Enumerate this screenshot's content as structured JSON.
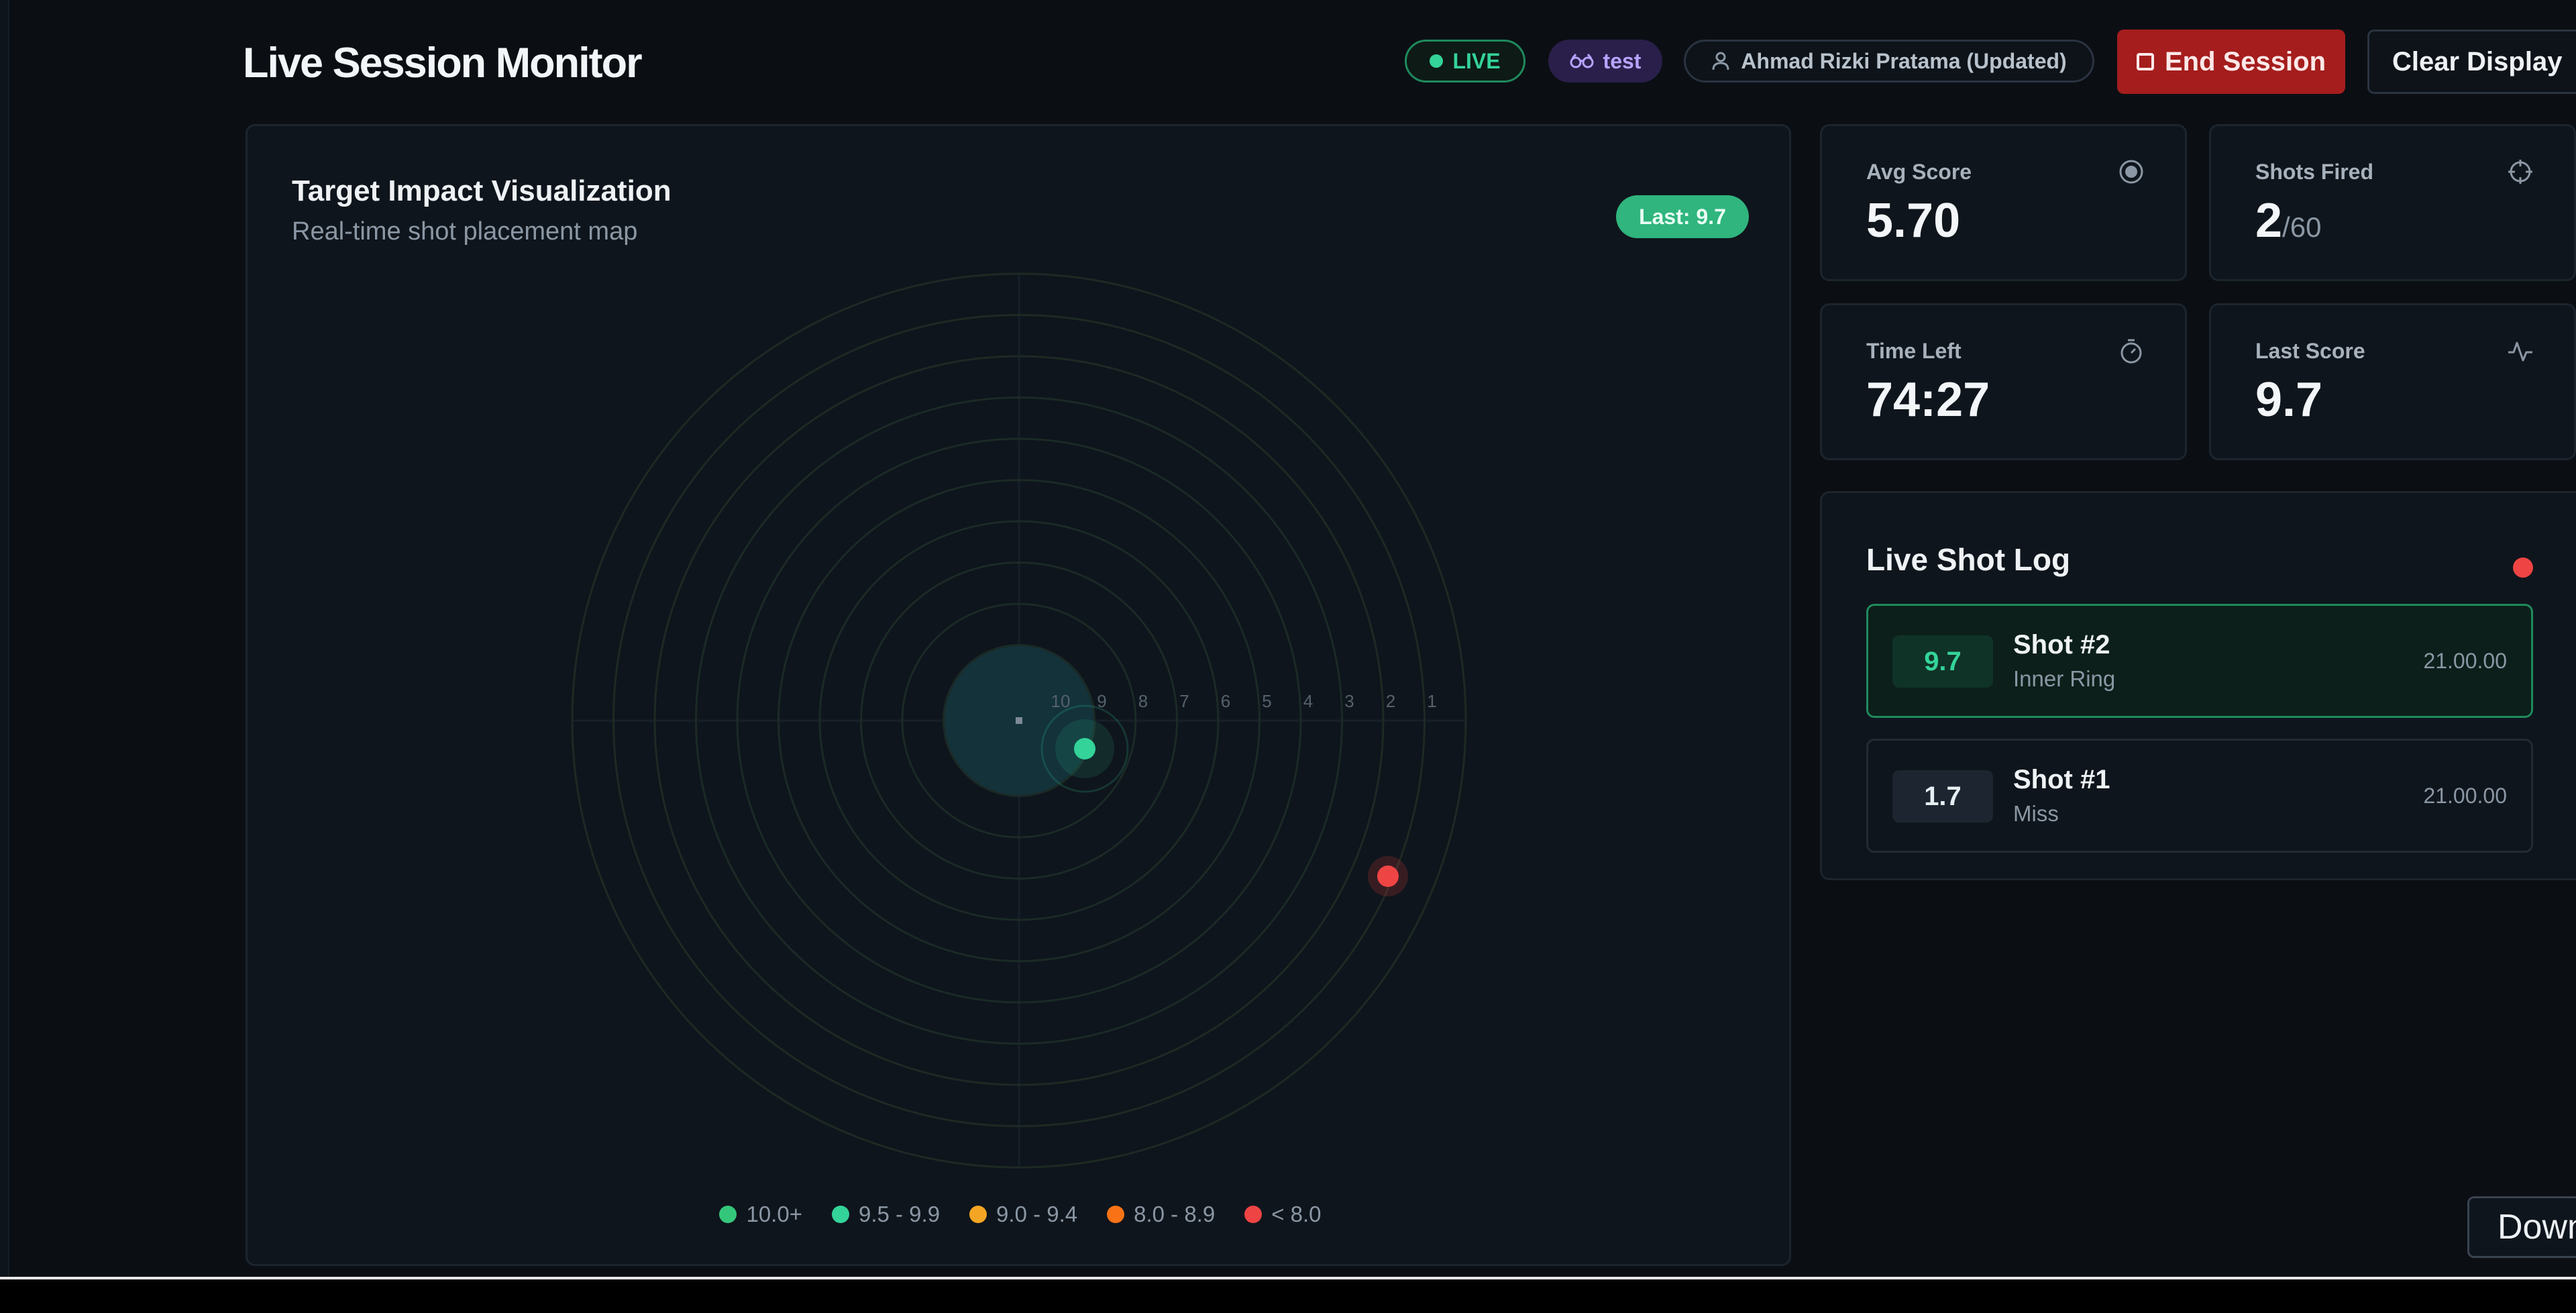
{
  "header": {
    "title": "Live Session Monitor",
    "live_label": "LIVE",
    "session_tag": "test",
    "user_label": "Ahmad Rizki Pratama (Updated)",
    "end_session_label": "End Session",
    "clear_display_label": "Clear Display"
  },
  "visualization": {
    "title": "Target Impact Visualization",
    "subtitle": "Real-time shot placement map",
    "last_badge": "Last: 9.7",
    "ring_labels": [
      "10",
      "9",
      "8",
      "7",
      "6",
      "5",
      "4",
      "3",
      "2",
      "1"
    ],
    "legend": [
      {
        "label": "10.0+",
        "color": "#34c77b"
      },
      {
        "label": "9.5 - 9.9",
        "color": "#34d399"
      },
      {
        "label": "9.0 - 9.4",
        "color": "#f5a524"
      },
      {
        "label": "8.0 - 8.9",
        "color": "#f97316"
      },
      {
        "label": "< 8.0",
        "color": "#ef4444"
      }
    ],
    "shots": [
      {
        "id": 2,
        "score": 9.7,
        "color": "#34d399"
      },
      {
        "id": 1,
        "score": 1.7,
        "color": "#ef4444"
      }
    ]
  },
  "stats": {
    "avg_score": {
      "label": "Avg Score",
      "value": "5.70",
      "icon": "target-icon"
    },
    "shots_fired": {
      "label": "Shots Fired",
      "value": "2",
      "total": "/60",
      "icon": "crosshair-icon"
    },
    "time_left": {
      "label": "Time Left",
      "value": "74:27",
      "icon": "stopwatch-icon"
    },
    "last_score": {
      "label": "Last Score",
      "value": "9.7",
      "icon": "activity-icon"
    }
  },
  "shot_log": {
    "title": "Live Shot Log",
    "items": [
      {
        "score": "9.7",
        "name": "Shot #2",
        "ring": "Inner Ring",
        "time": "21.00.00"
      },
      {
        "score": "1.7",
        "name": "Shot #1",
        "ring": "Miss",
        "time": "21.00.00"
      }
    ]
  },
  "floating": {
    "download_label": "Down"
  },
  "colors": {
    "accent_green": "#34d399",
    "danger_red": "#a51d1d",
    "background": "#0b0f14"
  }
}
